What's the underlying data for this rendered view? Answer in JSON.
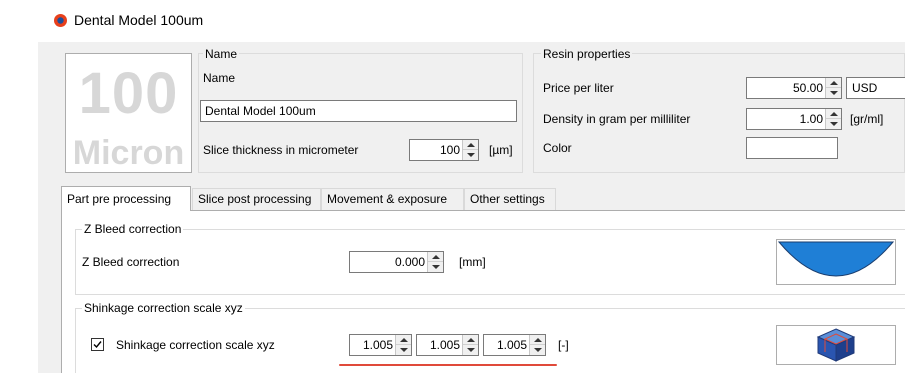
{
  "window": {
    "title": "Dental Model 100um"
  },
  "badge": {
    "number": "100",
    "unit": "Micron"
  },
  "name_group": {
    "header": "Name",
    "name_label": "Name",
    "name_value": "Dental Model 100um",
    "slice_label": "Slice thickness in micrometer",
    "slice_value": "100",
    "slice_unit": "[µm]"
  },
  "resin_group": {
    "header": "Resin properties",
    "price_label": "Price per liter",
    "price_value": "50.00",
    "currency": "USD",
    "density_label": "Density in gram per milliliter",
    "density_value": "1.00",
    "density_unit": "[gr/ml]",
    "color_label": "Color",
    "color_value": ""
  },
  "tabs": [
    {
      "label": "Part pre processing",
      "active": true
    },
    {
      "label": "Slice post processing",
      "active": false
    },
    {
      "label": "Movement & exposure",
      "active": false
    },
    {
      "label": "Other settings",
      "active": false
    }
  ],
  "zbleed": {
    "group_label": "Z Bleed correction",
    "label": "Z Bleed correction",
    "value": "0.000",
    "unit": "[mm]"
  },
  "shrinkage": {
    "group_label": "Shinkage correction scale xyz",
    "checkbox_label": "Shinkage correction scale xyz",
    "checked": true,
    "x": "1.005",
    "y": "1.005",
    "z": "1.005",
    "unit": "[-]"
  },
  "colors": {
    "accent_red": "#e8401c",
    "preview_blue": "#1f7fd6",
    "underline_red": "#e04a3a"
  }
}
